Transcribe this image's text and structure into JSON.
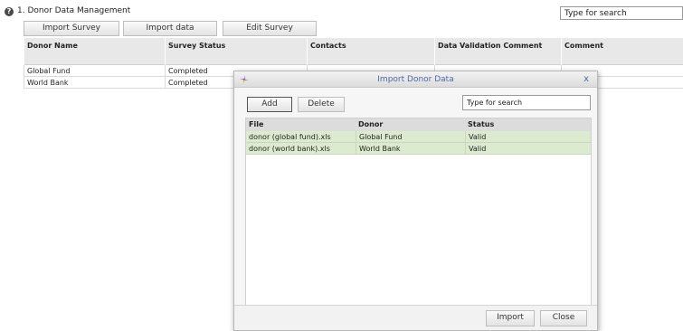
{
  "section": {
    "help_icon": "?",
    "title": "1. Donor Data Management"
  },
  "top_search": {
    "value": "Type for search"
  },
  "toolbar": {
    "import_survey": "Import Survey",
    "import_data": "Import data",
    "edit_survey": "Edit Survey"
  },
  "main_grid": {
    "headers": [
      "Donor Name",
      "Survey Status",
      "Contacts",
      "Data Validation Comment",
      "Comment"
    ],
    "rows": [
      [
        "Global Fund",
        "Completed",
        "",
        "",
        ""
      ],
      [
        "World Bank",
        "Completed",
        "",
        "",
        ""
      ]
    ]
  },
  "dialog": {
    "title": "Import Donor Data",
    "close_glyph": "x",
    "add_label": "Add",
    "delete_label": "Delete",
    "search_value": "Type for search",
    "headers": [
      "File",
      "Donor",
      "Status"
    ],
    "rows": [
      [
        "donor (global fund).xls",
        "Global Fund",
        "Valid"
      ],
      [
        "donor (world bank).xls",
        "World Bank",
        "Valid"
      ]
    ],
    "import_label": "Import",
    "close_label": "Close",
    "row_color": "#dcebd0"
  },
  "icons": {
    "help": "help-icon",
    "logo": "app-logo-icon",
    "close": "close-icon"
  }
}
